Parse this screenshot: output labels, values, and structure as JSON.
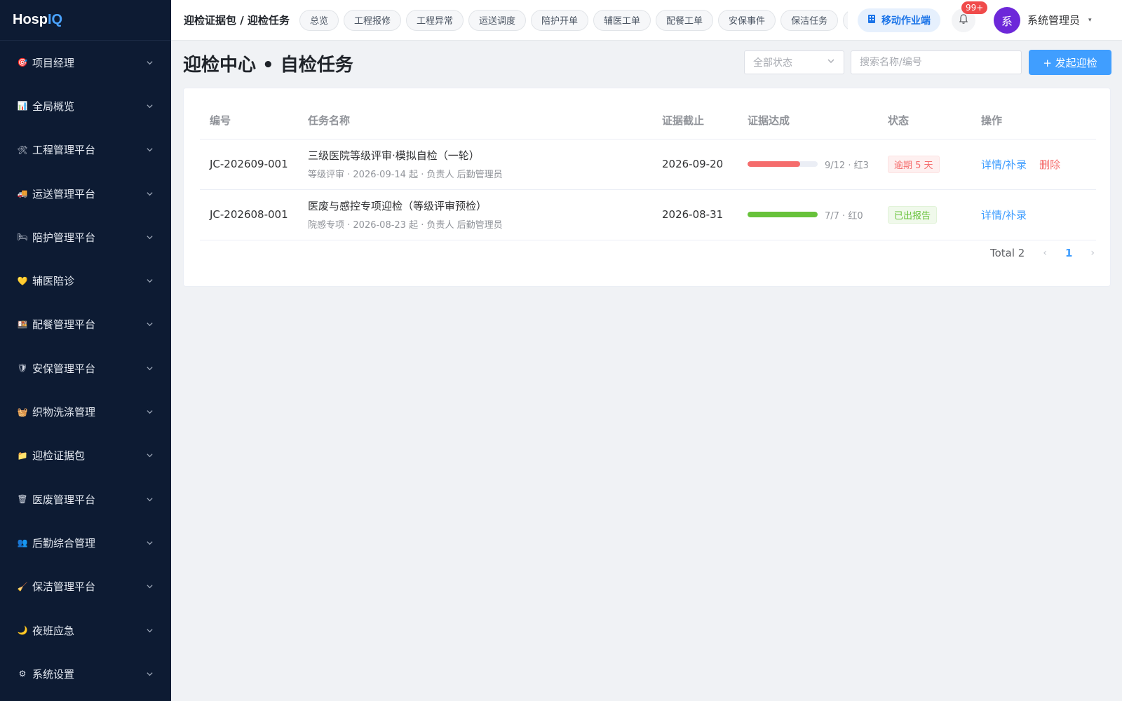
{
  "app": {
    "logo_main": "Hosp",
    "logo_accent": "IQ"
  },
  "sidebar": {
    "items": [
      {
        "label": "项目经理",
        "icon": "target-icon",
        "glyph": "🎯"
      },
      {
        "label": "全局概览",
        "icon": "chart-icon",
        "glyph": "📊"
      },
      {
        "label": "工程管理平台",
        "icon": "wrench-icon",
        "glyph": "🛠"
      },
      {
        "label": "运送管理平台",
        "icon": "truck-icon",
        "glyph": "🚚"
      },
      {
        "label": "陪护管理平台",
        "icon": "bed-icon",
        "glyph": "🛏"
      },
      {
        "label": "辅医陪诊",
        "icon": "heart-icon",
        "glyph": "💛"
      },
      {
        "label": "配餐管理平台",
        "icon": "meal-icon",
        "glyph": "🍱"
      },
      {
        "label": "安保管理平台",
        "icon": "shield-icon",
        "glyph": "🛡"
      },
      {
        "label": "织物洗涤管理",
        "icon": "basket-icon",
        "glyph": "🧺"
      },
      {
        "label": "迎检证据包",
        "icon": "folder-icon",
        "glyph": "📁"
      },
      {
        "label": "医废管理平台",
        "icon": "trash-icon",
        "glyph": "🗑"
      },
      {
        "label": "后勤综合管理",
        "icon": "users-icon",
        "glyph": "👥"
      },
      {
        "label": "保洁管理平台",
        "icon": "broom-icon",
        "glyph": "🧹"
      },
      {
        "label": "夜班应急",
        "icon": "moon-icon",
        "glyph": "🌙"
      },
      {
        "label": "系统设置",
        "icon": "gear-icon",
        "glyph": "⚙"
      }
    ]
  },
  "header": {
    "breadcrumb": "迎检证据包 / 迎检任务",
    "tabs": [
      "总览",
      "工程报修",
      "工程异常",
      "运送调度",
      "陪护开单",
      "辅医工单",
      "配餐工单",
      "安保事件",
      "保洁任务",
      ""
    ],
    "mobile_label": "移动作业端",
    "notif_count": "99+",
    "avatar_text": "系",
    "user_name": "系统管理员"
  },
  "page": {
    "title": "迎检中心 • 自检任务",
    "status_select": "全部状态",
    "search_placeholder": "搜索名称/编号",
    "create_label": "+ 发起迎检"
  },
  "table": {
    "headers": [
      "编号",
      "任务名称",
      "证据截止",
      "证据达成",
      "状态",
      "操作"
    ],
    "rows": [
      {
        "id": "JC-202609-001",
        "name": "三级医院等级评审·模拟自检（一轮）",
        "sub": "等级评审 · 2026-09-14 起 · 负责人 后勤管理员",
        "deadline": "2026-09-20",
        "progress": 0.75,
        "progress_color": "#f56c6c",
        "progress_label": "9/12 · 红3",
        "status": "逾期 5 天",
        "status_type": "danger",
        "action": "详情/补录",
        "delete": "删除"
      },
      {
        "id": "JC-202608-001",
        "name": "医废与感控专项迎检（等级评审预检）",
        "sub": "院感专项 · 2026-08-23 起 · 负责人 后勤管理员",
        "deadline": "2026-08-31",
        "progress": 1.0,
        "progress_color": "#67c23a",
        "progress_label": "7/7 · 红0",
        "status": "已出报告",
        "status_type": "success",
        "action": "详情/补录",
        "delete": ""
      }
    ]
  },
  "pagination": {
    "total": "Total 2",
    "current": "1"
  }
}
